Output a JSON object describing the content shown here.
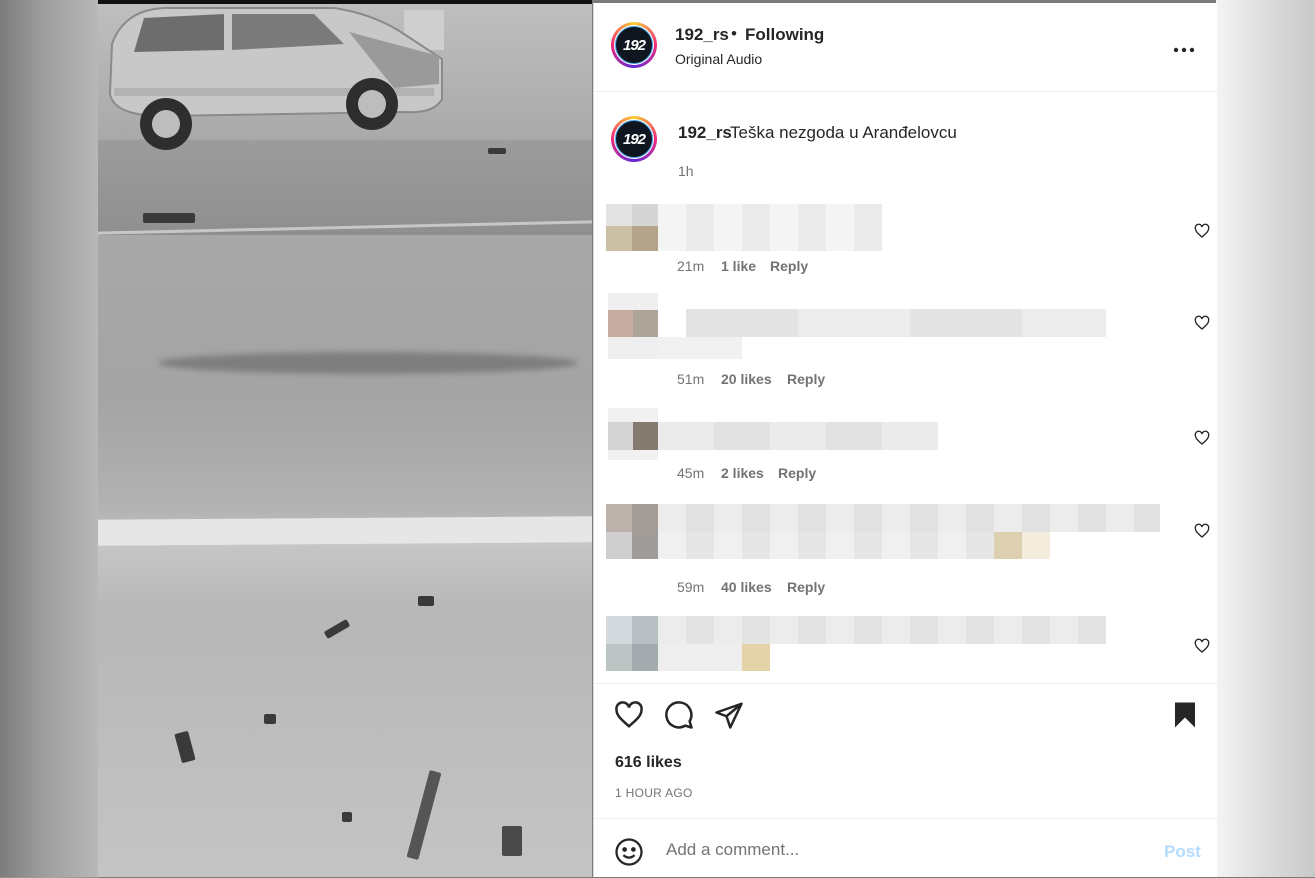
{
  "header": {
    "username": "192_rs",
    "separator": "•",
    "follow_status": "Following",
    "audio_label": "Original Audio",
    "avatar_text": "192",
    "more_icon": "more-horizontal-icon"
  },
  "caption": {
    "username": "192_rs",
    "text": "Teška nezgoda u Aranđelovcu",
    "time": "1h"
  },
  "comments": [
    {
      "time": "21m",
      "likes": "1 like",
      "reply": "Reply"
    },
    {
      "time": "51m",
      "likes": "20 likes",
      "reply": "Reply"
    },
    {
      "time": "45m",
      "likes": "2 likes",
      "reply": "Reply"
    },
    {
      "time": "59m",
      "likes": "40 likes",
      "reply": "Reply"
    }
  ],
  "actions": {
    "like_icon": "heart-icon",
    "comment_icon": "comment-icon",
    "share_icon": "send-icon",
    "save_icon": "bookmark-icon",
    "likes": "616 likes",
    "posted_ago": "1 HOUR AGO"
  },
  "comment_box": {
    "placeholder": "Add a comment...",
    "post_label": "Post",
    "emoji_icon": "emoji-icon"
  },
  "media": {
    "mute_icon": "muted-speaker-icon"
  },
  "colors": {
    "text": "#262626",
    "secondary": "#737373",
    "post_disabled": "#b3dbff",
    "border": "#efefef"
  }
}
